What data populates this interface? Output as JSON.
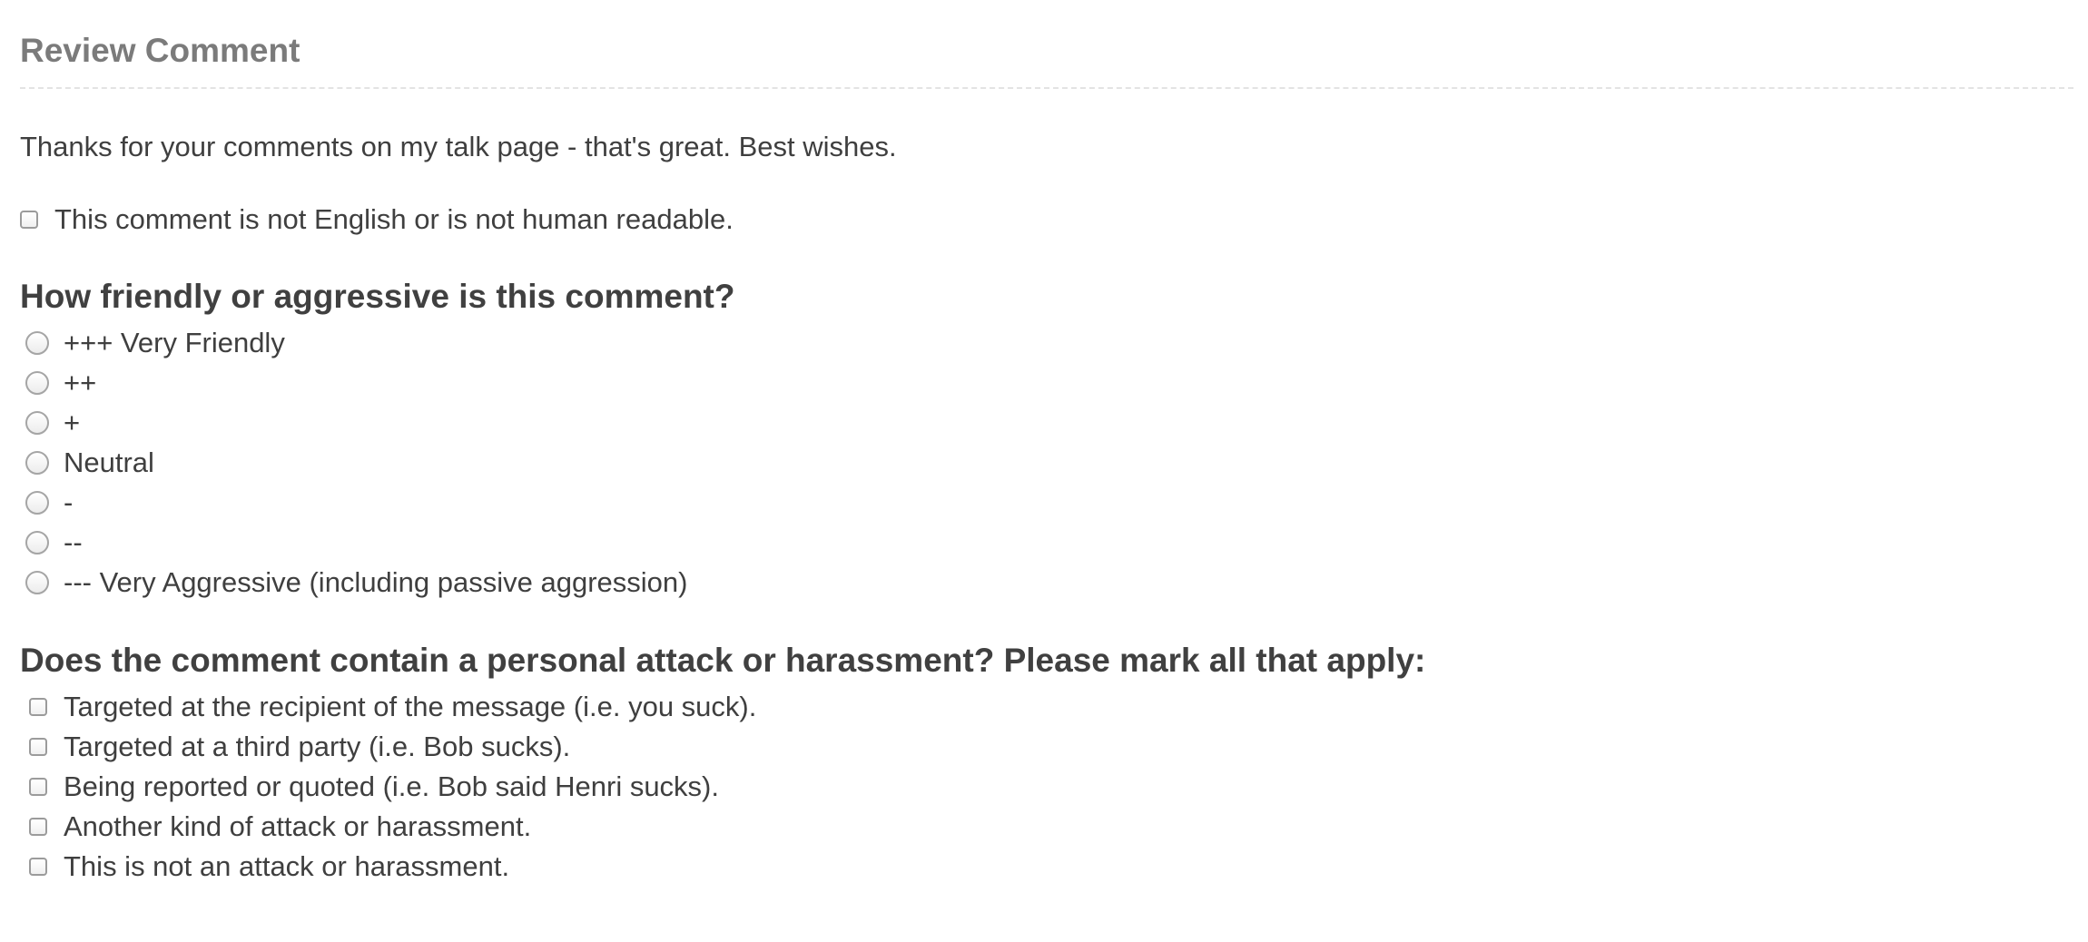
{
  "header": {
    "title": "Review Comment"
  },
  "comment": {
    "text": "Thanks for your comments on my talk page - that's great. Best wishes."
  },
  "not_english": {
    "label": "This comment is not English or is not human readable.",
    "checked": false
  },
  "friendliness": {
    "question": "How friendly or aggressive is this comment?",
    "options": [
      {
        "label": "+++ Very Friendly",
        "selected": false
      },
      {
        "label": "++",
        "selected": false
      },
      {
        "label": "+",
        "selected": false
      },
      {
        "label": "Neutral",
        "selected": false
      },
      {
        "label": "-",
        "selected": false
      },
      {
        "label": "--",
        "selected": false
      },
      {
        "label": "--- Very Aggressive (including passive aggression)",
        "selected": false
      }
    ]
  },
  "attack": {
    "question": "Does the comment contain a personal attack or harassment? Please mark all that apply:",
    "options": [
      {
        "label": "Targeted at the recipient of the message (i.e. you suck).",
        "checked": false
      },
      {
        "label": "Targeted at a third party (i.e. Bob sucks).",
        "checked": false
      },
      {
        "label": "Being reported or quoted (i.e. Bob said Henri sucks).",
        "checked": false
      },
      {
        "label": "Another kind of attack or harassment.",
        "checked": false
      },
      {
        "label": "This is not an attack or harassment.",
        "checked": false
      }
    ]
  }
}
